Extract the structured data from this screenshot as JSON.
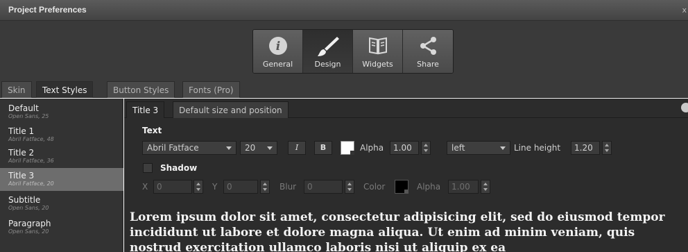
{
  "window": {
    "title": "Project Preferences",
    "close_label": "x"
  },
  "toolbar": {
    "buttons": [
      {
        "label": "General",
        "icon": "info-icon"
      },
      {
        "label": "Design",
        "icon": "brush-icon"
      },
      {
        "label": "Widgets",
        "icon": "book-icon"
      },
      {
        "label": "Share",
        "icon": "share-icon"
      }
    ],
    "active": "Design"
  },
  "tabs": [
    "Skin",
    "Text Styles",
    "Button Styles",
    "Fonts (Pro)"
  ],
  "active_tab": "Text Styles",
  "sidebar": {
    "items": [
      {
        "name": "Default",
        "sub": "Open Sans, 25"
      },
      {
        "name": "Title 1",
        "sub": "Abril Fatface, 48"
      },
      {
        "name": "Title 2",
        "sub": "Abril Fatface, 36"
      },
      {
        "name": "Title 3",
        "sub": "Abril Fatface, 20"
      },
      {
        "name": "Subtitle",
        "sub": "Open Sans, 20"
      },
      {
        "name": "Paragraph",
        "sub": "Open Sans, 20"
      }
    ],
    "selected": "Title 3"
  },
  "editor": {
    "tabs": [
      "Title 3",
      "Default size and position"
    ],
    "text_label": "Text",
    "font": "Abril Fatface",
    "size": "20",
    "italic": "I",
    "bold": "B",
    "text_color": "#ffffff",
    "alpha_label": "Alpha",
    "alpha": "1.00",
    "align": "left",
    "line_height_label": "Line height",
    "line_height": "1.20",
    "shadow_label": "Shadow",
    "x_label": "X",
    "x": "0",
    "y_label": "Y",
    "y": "0",
    "blur_label": "Blur",
    "blur": "0",
    "color_label": "Color",
    "shadow_color": "#000000",
    "shadow_alpha_label": "Alpha",
    "shadow_alpha": "1.00"
  },
  "preview": {
    "text": "Lorem ipsum dolor sit amet, consectetur adipisicing elit, sed do eiusmod tempor incididunt ut labore et dolore magna aliqua. Ut enim ad minim veniam, quis nostrud exercitation ullamco laboris nisi ut aliquip ex ea"
  }
}
